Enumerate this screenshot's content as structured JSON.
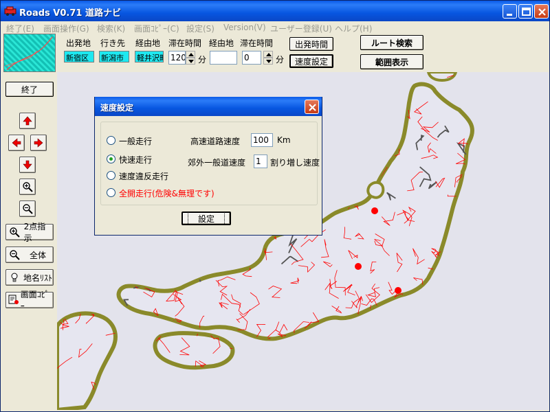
{
  "window": {
    "title": "Roads V0.71 道路ナビ",
    "menu": [
      "終了(E)",
      "画面操作(G)",
      "検索(K)",
      "画面ｺﾋﾟｰ(C)",
      "設定(S)",
      "Version(V)",
      "ユーザー登録(U)",
      "ヘルプ(H)"
    ]
  },
  "toolbar": {
    "origin_label": "出発地",
    "origin_value": "新宿区",
    "dest_label": "行き先",
    "dest_value": "新潟市",
    "via_label": "経由地",
    "via_value": "軽井沢町",
    "stay_label": "滞在時間",
    "stay_value": "120",
    "stay_unit": "分",
    "via2_label": "経由地",
    "via2_value": "",
    "stay2_label": "滞在時間",
    "stay2_value": "0",
    "stay2_unit": "分",
    "depart_time_button": "出発時間",
    "speed_settings_button": "速度設定",
    "route_search_button": "ルート検索",
    "range_display_button": "範囲表示"
  },
  "sidebar": {
    "exit_button": "終了",
    "two_point_button": "2点指示",
    "whole_button": "全体",
    "place_list_button": "地名ﾘｽﾄ",
    "screen_copy_button": "画面ｺﾋﾟｰ"
  },
  "dialog": {
    "title": "速度設定",
    "options": [
      {
        "label": "一般走行",
        "selected": false,
        "color": "#000000"
      },
      {
        "label": "快速走行",
        "selected": true,
        "color": "#000000"
      },
      {
        "label": "速度違反走行",
        "selected": false,
        "color": "#000000"
      },
      {
        "label": "全開走行(危険&無理です)",
        "selected": false,
        "color": "#ff0000"
      }
    ],
    "highway_label": "高速道路速度",
    "highway_value": "100",
    "highway_unit": "Km",
    "suburban_label": "郊外一般道速度",
    "suburban_value": "1",
    "suburban_unit": "割り増し速度",
    "ok_button": "設定"
  },
  "map": {
    "land_color": "#e6e6f0",
    "coast_color": "#8a8a2a",
    "road_color": "#ff0000",
    "highway_color": "#555555",
    "marker_color": "#ff0000"
  }
}
